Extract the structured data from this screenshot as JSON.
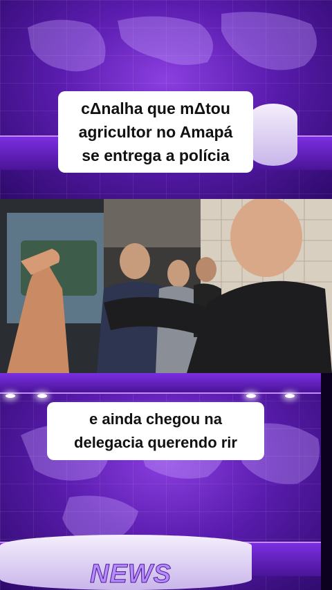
{
  "captions": {
    "top_line1": "cΔnalha que mΔtou",
    "top_line2": "agricultor no Amapá",
    "top_line3": "se entrega a polícia",
    "bottom_line1": "e ainda chegou na",
    "bottom_line2": "delegacia querendo rir"
  },
  "branding": {
    "news_label": "NEWS"
  },
  "colors": {
    "background_purple": "#5a1cae",
    "accent_lilac": "#c68cff",
    "caption_bg": "#ffffff"
  },
  "icons": {
    "world_map": "world-map-icon"
  }
}
